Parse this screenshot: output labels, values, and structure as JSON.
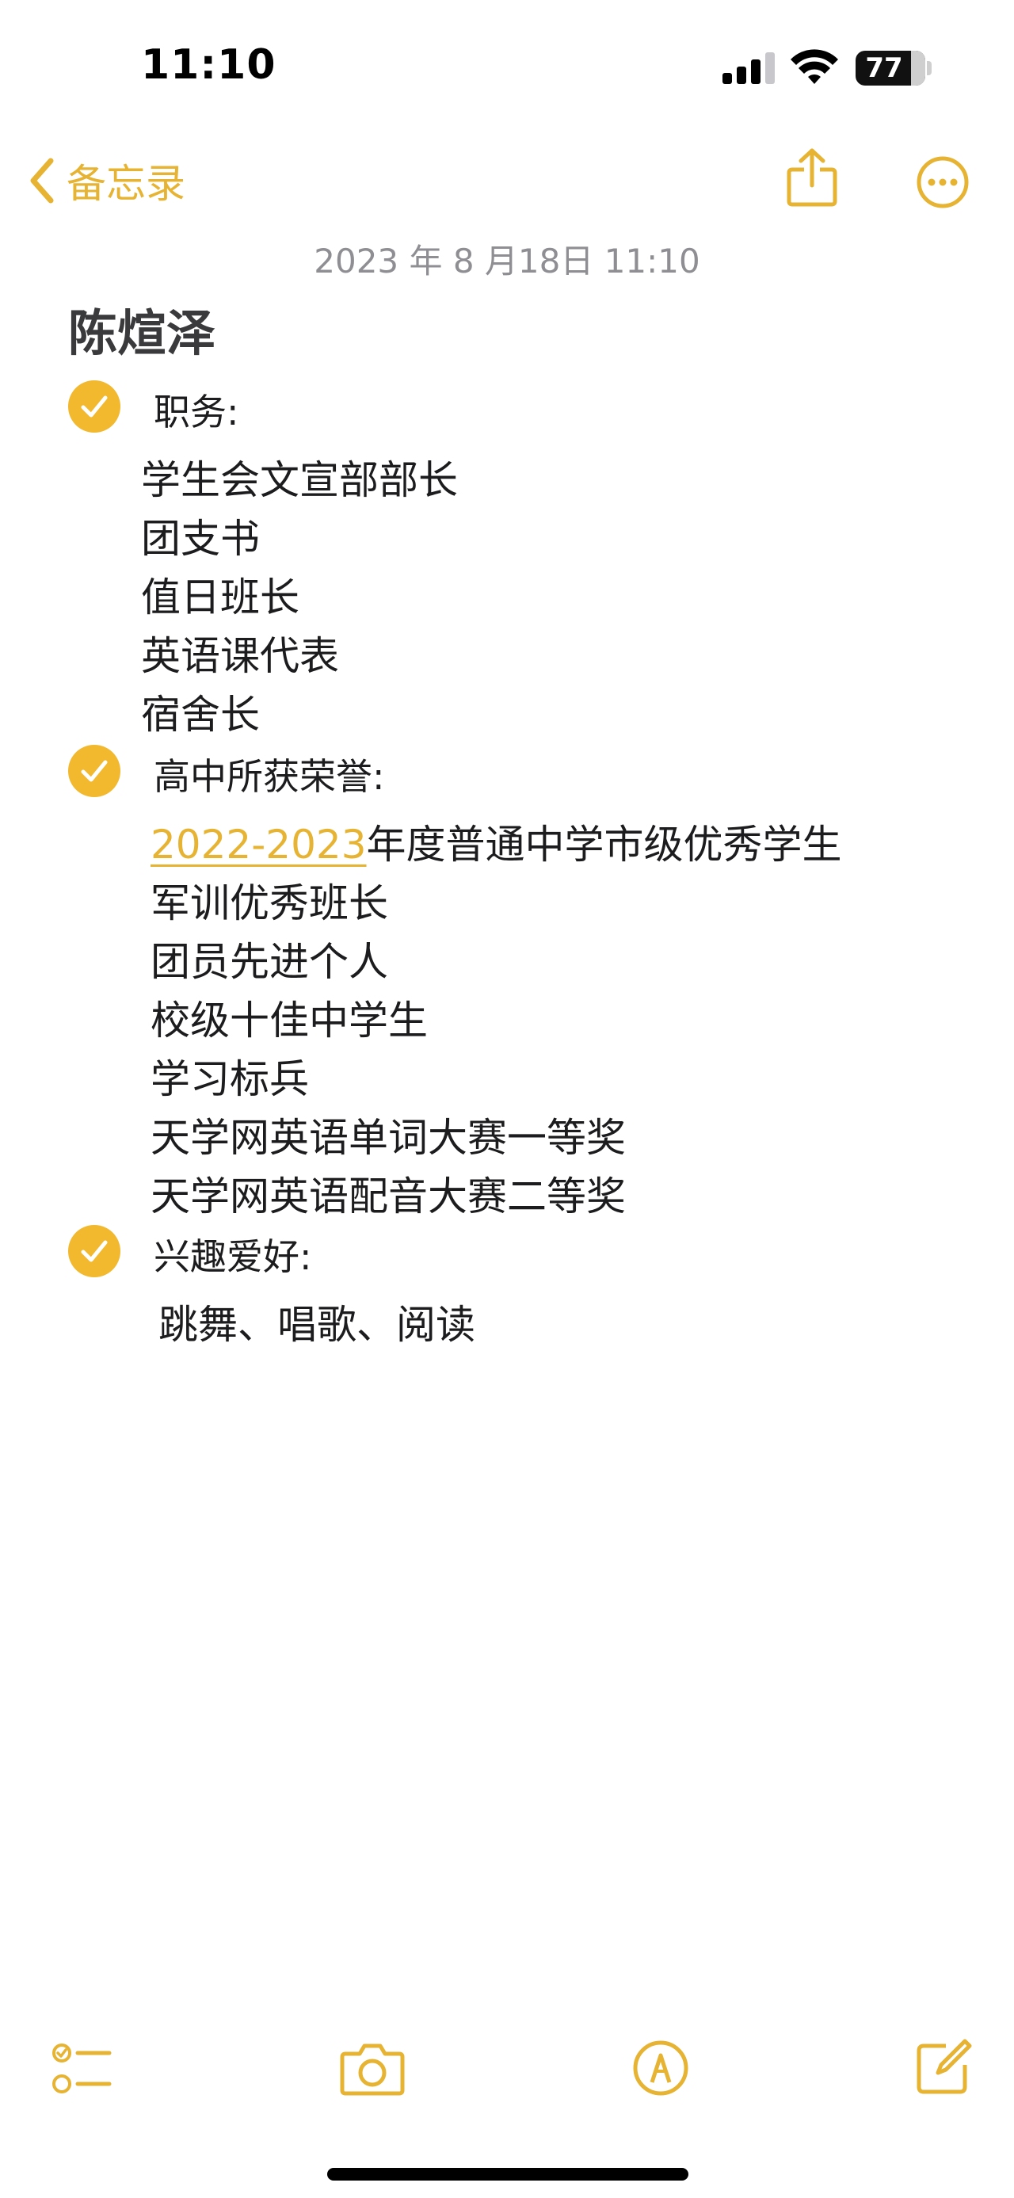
{
  "status_bar": {
    "time": "11:10",
    "battery": "77"
  },
  "nav": {
    "back_label": "备忘录"
  },
  "note": {
    "date": "2023 年 8 月18日 11:10",
    "title": "陈煊泽",
    "sections": [
      {
        "heading": "职务:",
        "checked": true,
        "items": [
          "学生会文宣部部长",
          "团支书",
          "值日班长",
          "英语课代表",
          "宿舍长"
        ]
      },
      {
        "heading": "高中所获荣誉:",
        "checked": true,
        "first_item_link": "2022-2023",
        "first_item_rest": "年度普通中学市级优秀学生",
        "items": [
          "军训优秀班长",
          "团员先进个人",
          "校级十佳中学生",
          "学习标兵",
          "天学网英语单词大赛一等奖",
          "天学网英语配音大赛二等奖"
        ]
      },
      {
        "heading": "兴趣爱好:",
        "checked": true,
        "items": [
          "跳舞、唱歌、阅读"
        ]
      }
    ]
  },
  "colors": {
    "accent": "#e6b332",
    "check_fill": "#f2b82e",
    "date_gray": "#8e8e93"
  },
  "icons": {
    "back": "chevron-left-icon",
    "share": "share-icon",
    "more": "ellipsis-circle-icon",
    "checklist": "checklist-icon",
    "camera": "camera-icon",
    "markup": "pen-circle-icon",
    "compose": "compose-icon"
  }
}
